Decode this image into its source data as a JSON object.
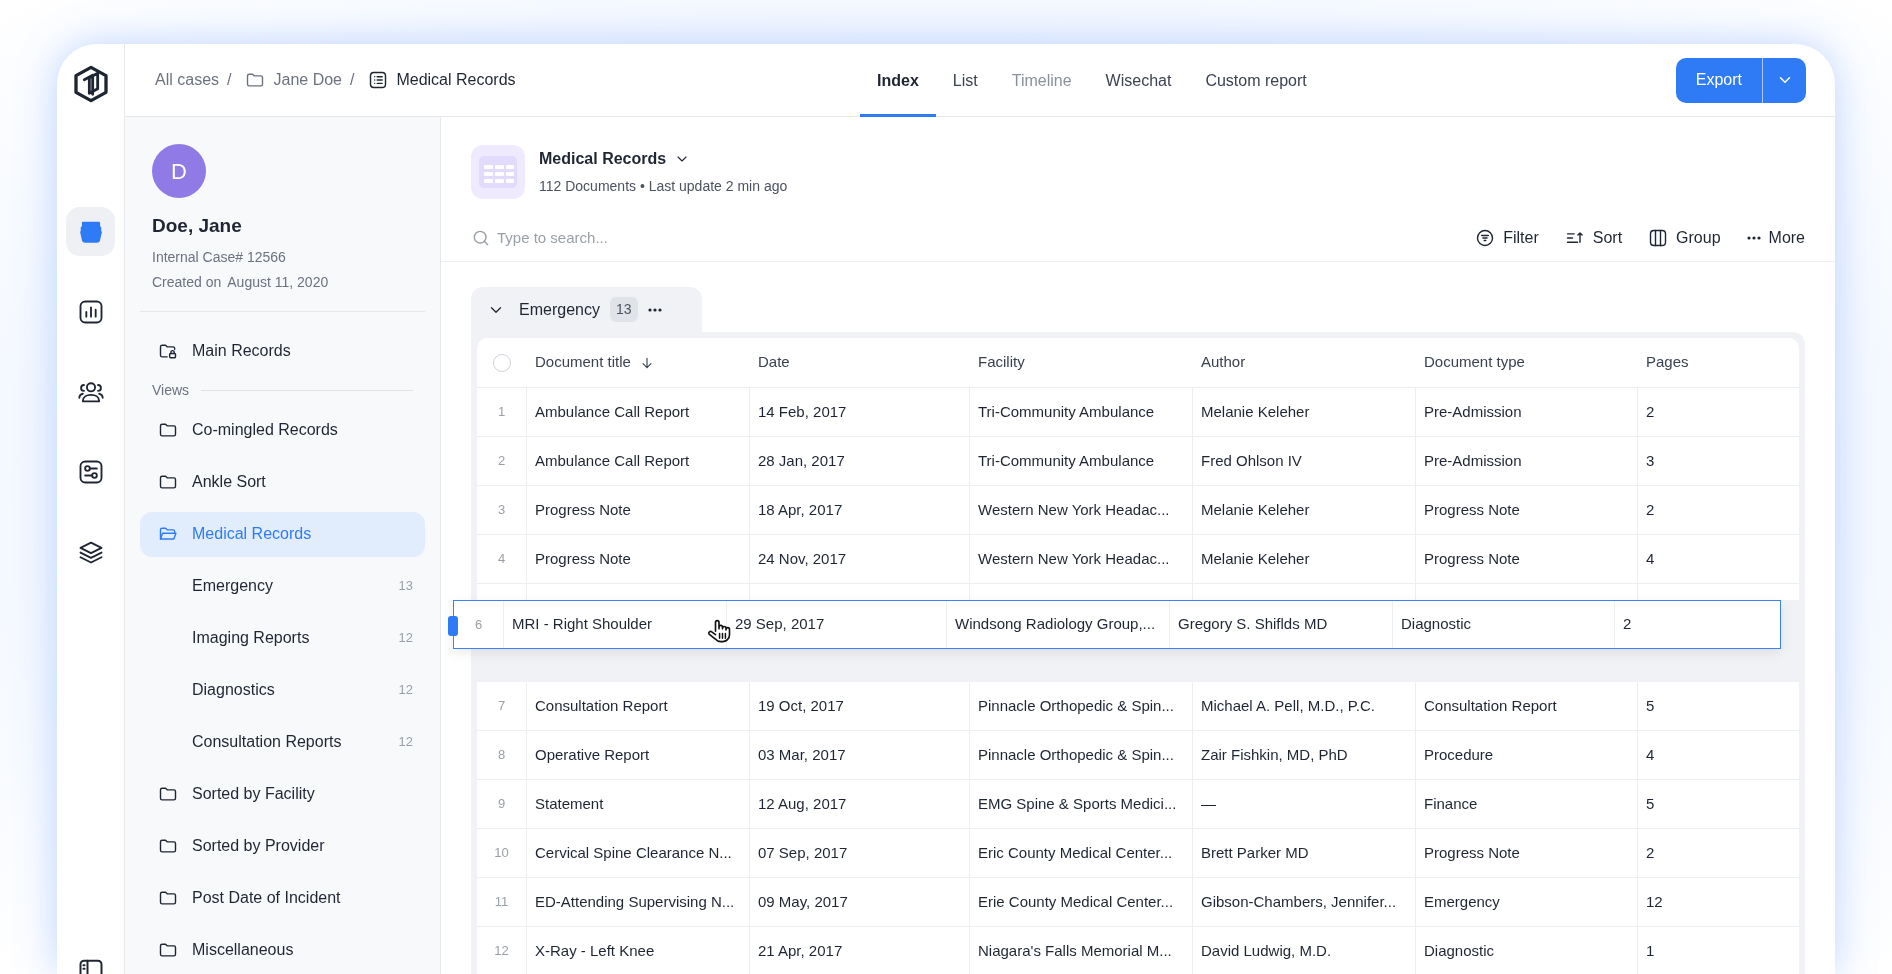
{
  "rail": [
    {
      "kind": "stack",
      "selected": true
    },
    {
      "kind": "chart",
      "selected": false
    },
    {
      "kind": "people",
      "selected": false
    },
    {
      "kind": "sliders",
      "selected": false
    },
    {
      "kind": "layers",
      "selected": false
    }
  ],
  "breadcrumb": {
    "separator": "/",
    "items": [
      {
        "label": "All cases"
      },
      {
        "label": "Jane Doe"
      },
      {
        "label": "Medical Records"
      }
    ]
  },
  "tabs": [
    {
      "label": "Index",
      "selected": true,
      "disabled": false
    },
    {
      "label": "List",
      "selected": false,
      "disabled": false
    },
    {
      "label": "Timeline",
      "selected": false,
      "disabled": true
    },
    {
      "label": "Wisechat",
      "selected": false,
      "disabled": false
    },
    {
      "label": "Custom report",
      "selected": false,
      "disabled": false
    }
  ],
  "export": {
    "label": "Export"
  },
  "profile": {
    "initial": "D",
    "name": "Doe, Jane",
    "case": "Internal Case# 12566",
    "created_label": "Created on",
    "created_date": "August 11, 2020"
  },
  "sidebar": {
    "main_item": {
      "label": "Main Records"
    },
    "views_label": "Views",
    "views": [
      {
        "label": "Co-mingled Records",
        "selected": false
      },
      {
        "label": "Ankle Sort",
        "selected": false
      },
      {
        "label": "Medical Records",
        "selected": true,
        "children": [
          {
            "label": "Emergency",
            "count": "13"
          },
          {
            "label": "Imaging Reports",
            "count": "12"
          },
          {
            "label": "Diagnostics",
            "count": "12"
          },
          {
            "label": "Consultation Reports",
            "count": "12"
          }
        ]
      },
      {
        "label": "Sorted by Facility",
        "selected": false
      },
      {
        "label": "Sorted by Provider",
        "selected": false
      },
      {
        "label": "Post Date of Incident",
        "selected": false
      },
      {
        "label": "Miscellaneous",
        "selected": false
      }
    ]
  },
  "document": {
    "title": "Medical Records",
    "subtitle": "112 Documents • Last update 2 min ago"
  },
  "search": {
    "placeholder": "Type to search..."
  },
  "toolbar": [
    {
      "kind": "filter",
      "label": "Filter"
    },
    {
      "kind": "sort",
      "label": "Sort"
    },
    {
      "kind": "group",
      "label": "Group"
    },
    {
      "kind": "more",
      "label": "More"
    }
  ],
  "group": {
    "label": "Emergency",
    "count": "13",
    "expanded": true
  },
  "table": {
    "select_all": {
      "checked": false
    },
    "columns": [
      {
        "label": "Document title",
        "sorted": true
      },
      {
        "label": "Date",
        "sorted": false
      },
      {
        "label": "Facility",
        "sorted": false
      },
      {
        "label": "Author",
        "sorted": false
      },
      {
        "label": "Document type",
        "sorted": false
      },
      {
        "label": "Pages",
        "sorted": false
      }
    ],
    "rows": [
      {
        "number": "1",
        "dragging": false,
        "cells": [
          "Ambulance Call Report",
          "14 Feb, 2017",
          "Tri-Community Ambulance",
          "Melanie Keleher",
          "Pre-Admission",
          "2"
        ]
      },
      {
        "number": "2",
        "dragging": false,
        "cells": [
          "Ambulance Call Report",
          "28 Jan, 2017",
          "Tri-Community Ambulance",
          "Fred Ohlson IV",
          "Pre-Admission",
          "3"
        ]
      },
      {
        "number": "3",
        "dragging": false,
        "cells": [
          "Progress Note",
          "18 Apr, 2017",
          "Western New York Headac...",
          "Melanie Keleher",
          "Progress Note",
          "2"
        ]
      },
      {
        "number": "4",
        "dragging": false,
        "cells": [
          "Progress Note",
          "24 Nov, 2017",
          "Western New York Headac...",
          "Melanie Keleher",
          "Progress Note",
          "4"
        ]
      },
      {
        "number": "6",
        "dragging": true,
        "cells": [
          "MRI - Right Shoulder",
          "29 Sep, 2017",
          "Windsong Radiology Group,...",
          "Gregory S. Shiflds MD",
          "Diagnostic",
          "2"
        ]
      },
      {
        "number": "7",
        "dragging": false,
        "cells": [
          "Consultation Report",
          "19 Oct, 2017",
          "Pinnacle Orthopedic & Spin...",
          "Michael A. Pell, M.D., P.C.",
          "Consultation Report",
          "5"
        ]
      },
      {
        "number": "8",
        "dragging": false,
        "cells": [
          "Operative Report",
          "03 Mar, 2017",
          "Pinnacle Orthopedic & Spin...",
          "Zair Fishkin, MD, PhD",
          "Procedure",
          "4"
        ]
      },
      {
        "number": "9",
        "dragging": false,
        "cells": [
          "Statement",
          "12 Aug, 2017",
          "EMG Spine & Sports Medici...",
          "—",
          "Finance",
          "5"
        ]
      },
      {
        "number": "10",
        "dragging": false,
        "cells": [
          "Cervical Spine Clearance N...",
          "07 Sep, 2017",
          "Eric County Medical Center...",
          "Brett Parker MD",
          "Progress Note",
          "2"
        ]
      },
      {
        "number": "11",
        "dragging": false,
        "cells": [
          "ED-Attending Supervising N...",
          "09 May, 2017",
          "Erie County Medical Center...",
          "Gibson-Chambers, Jennifer...",
          "Emergency",
          "12"
        ]
      },
      {
        "number": "12",
        "dragging": false,
        "cells": [
          "X-Ray - Left Knee",
          "21 Apr, 2017",
          "Niagara's Falls Memorial M...",
          "David Ludwig, M.D.",
          "Diagnostic",
          "1"
        ]
      }
    ]
  }
}
